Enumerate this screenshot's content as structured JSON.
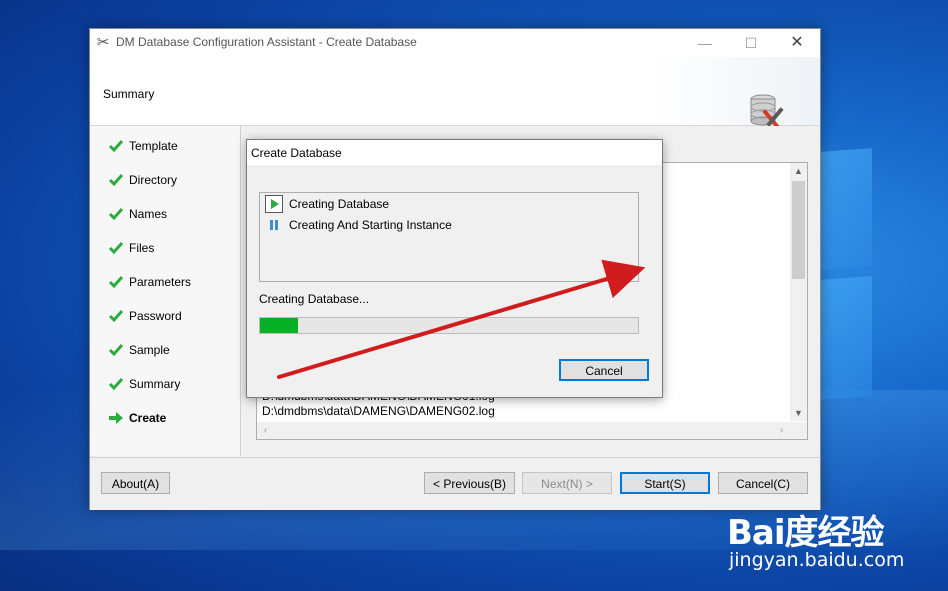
{
  "window": {
    "title": "DM Database Configuration Assistant - Create Database",
    "controls": {
      "minimize": "—",
      "maximize": "☐",
      "close": "✕"
    }
  },
  "header": {
    "title": "Summary"
  },
  "steps": [
    {
      "label": "Template",
      "state": "done"
    },
    {
      "label": "Directory",
      "state": "done"
    },
    {
      "label": "Names",
      "state": "done"
    },
    {
      "label": "Files",
      "state": "done"
    },
    {
      "label": "Parameters",
      "state": "done"
    },
    {
      "label": "Password",
      "state": "done"
    },
    {
      "label": "Sample",
      "state": "done"
    },
    {
      "label": "Summary",
      "state": "done"
    },
    {
      "label": "Create",
      "state": "active"
    }
  ],
  "summary_lines": [
    "D:\\dmdbms\\data\\DAMENG\\DAMENG01.log",
    "D:\\dmdbms\\data\\DAMENG\\DAMENG02.log"
  ],
  "buttons": {
    "about": "About(A)",
    "previous": "< Previous(B)",
    "next": "Next(N) >",
    "start": "Start(S)",
    "cancel": "Cancel(C)"
  },
  "dialog": {
    "title": "Create Database",
    "tasks": [
      {
        "label": "Creating Database",
        "state": "running"
      },
      {
        "label": "Creating And Starting Instance",
        "state": "pending"
      }
    ],
    "status": "Creating Database...",
    "progress": 0.1,
    "cancel": "Cancel"
  },
  "colors": {
    "progress_fill": "#06b025",
    "check": "#2bab3d",
    "arrow": "#d01c1c"
  },
  "watermark": {
    "logo": "Bai度经验",
    "url": "jingyan.baidu.com"
  }
}
